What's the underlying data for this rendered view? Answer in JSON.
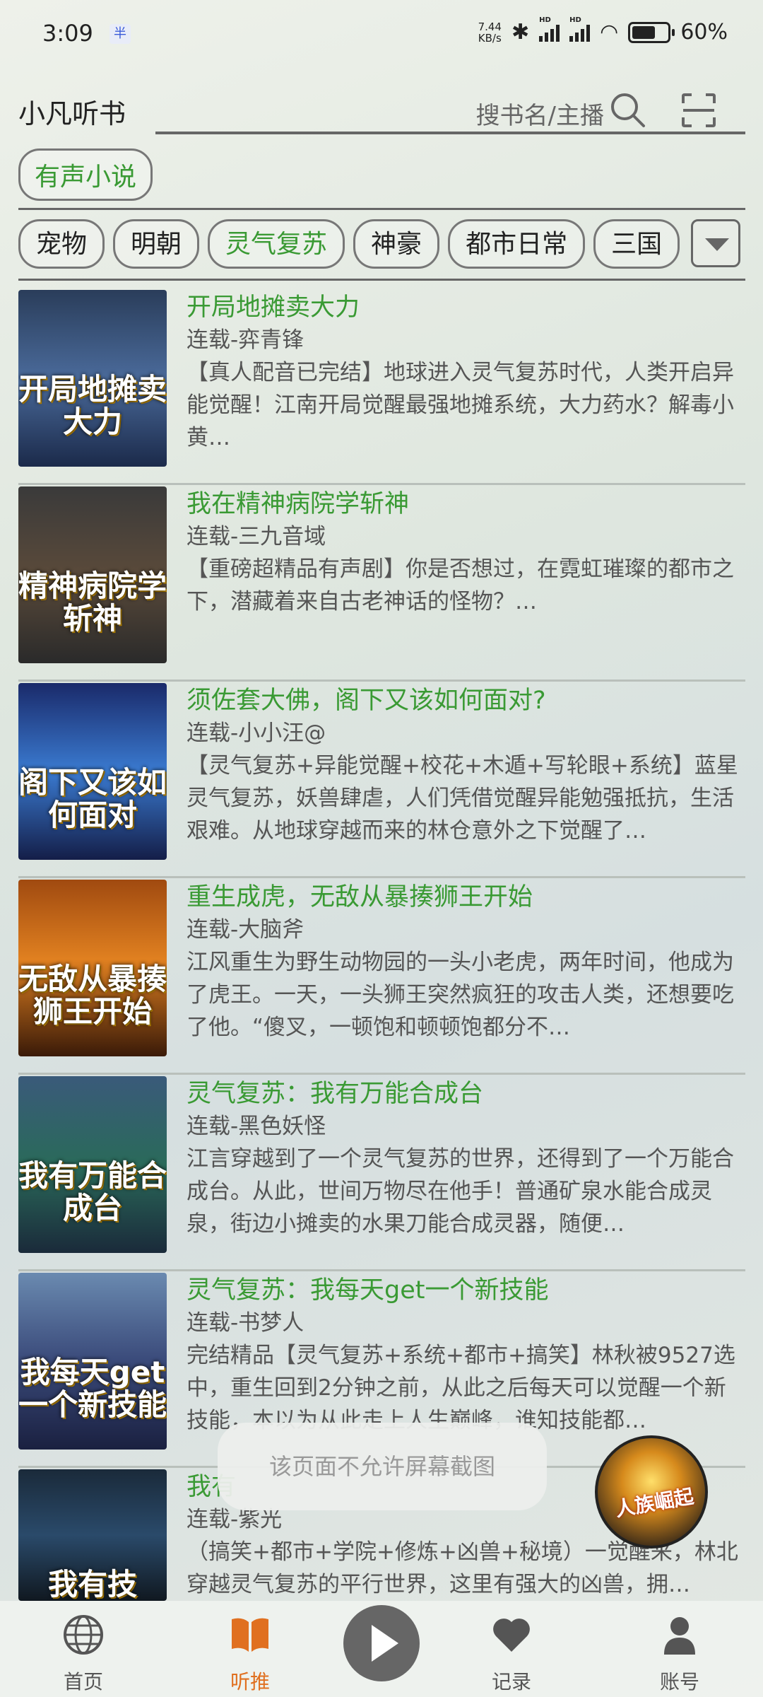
{
  "status_bar": {
    "time": "3:09",
    "speed_value": "7.44",
    "speed_unit": "KB/s",
    "battery": "60%"
  },
  "header": {
    "title": "小凡听书",
    "search_placeholder": "搜书名/主播"
  },
  "category": {
    "label": "有声小说"
  },
  "tags": [
    "宠物",
    "明朝",
    "灵气复苏",
    "神豪",
    "都市日常",
    "三国"
  ],
  "active_tag": "灵气复苏",
  "books": [
    {
      "title": "开局地摊卖大力",
      "meta": "连载-弈青锋",
      "desc": "【真人配音已完结】地球进入灵气复苏时代，人类开启异能觉醒！江南开局觉醒最强地摊系统，大力药水？解毒小黄…",
      "cover_text": "开局地摊卖大力"
    },
    {
      "title": "我在精神病院学斩神",
      "meta": "连载-三九音域",
      "desc": "【重磅超精品有声剧】你是否想过，在霓虹璀璨的都市之下，潜藏着来自古老神话的怪物？…",
      "cover_text": "精神病院学斩神"
    },
    {
      "title": "须佐套大佛，阁下又该如何面对?",
      "meta": "连载-小小汪@",
      "desc": "【灵气复苏+异能觉醒+校花+木遁+写轮眼+系统】蓝星灵气复苏，妖兽肆虐，人们凭借觉醒异能勉强抵抗，生活艰难。从地球穿越而来的林仓意外之下觉醒了…",
      "cover_text": "阁下又该如何面对"
    },
    {
      "title": "重生成虎，无敌从暴揍狮王开始",
      "meta": "连载-大脑斧",
      "desc": "江风重生为野生动物园的一头小老虎，两年时间，他成为了虎王。一天，一头狮王突然疯狂的攻击人类，还想要吃了他。“傻叉，一顿饱和顿顿饱都分不…",
      "cover_text": "无敌从暴揍狮王开始"
    },
    {
      "title": "灵气复苏：我有万能合成台",
      "meta": "连载-黑色妖怪",
      "desc": "江言穿越到了一个灵气复苏的世界，还得到了一个万能合成台。从此，世间万物尽在他手！普通矿泉水能合成灵泉，街边小摊卖的水果刀能合成灵器，随便…",
      "cover_text": "我有万能合成台"
    },
    {
      "title": "灵气复苏：我每天get一个新技能",
      "meta": "连载-书梦人",
      "desc": "完结精品【灵气复苏+系统+都市+搞笑】林秋被9527选中，重生回到2分钟之前，从此之后每天可以觉醒一个新技能，本以为从此走上人生巅峰，谁知技能都…",
      "cover_text": "我每天get一个新技能"
    },
    {
      "title": "我有",
      "meta": "连载-紫光",
      "desc": "（搞笑+都市+学院+修炼+凶兽+秘境）一觉醒来，林北穿越灵气复苏的平行世界，这里有强大的凶兽，拥…",
      "cover_text": "我有技"
    }
  ],
  "toast": "该页面不允许屏幕截图",
  "floating_player_text": "人族崛起",
  "nav": {
    "home": "首页",
    "recommend": "听推",
    "history": "记录",
    "account": "账号"
  },
  "colors": {
    "accent_green": "#3a9a34",
    "active_orange": "#e07020"
  }
}
